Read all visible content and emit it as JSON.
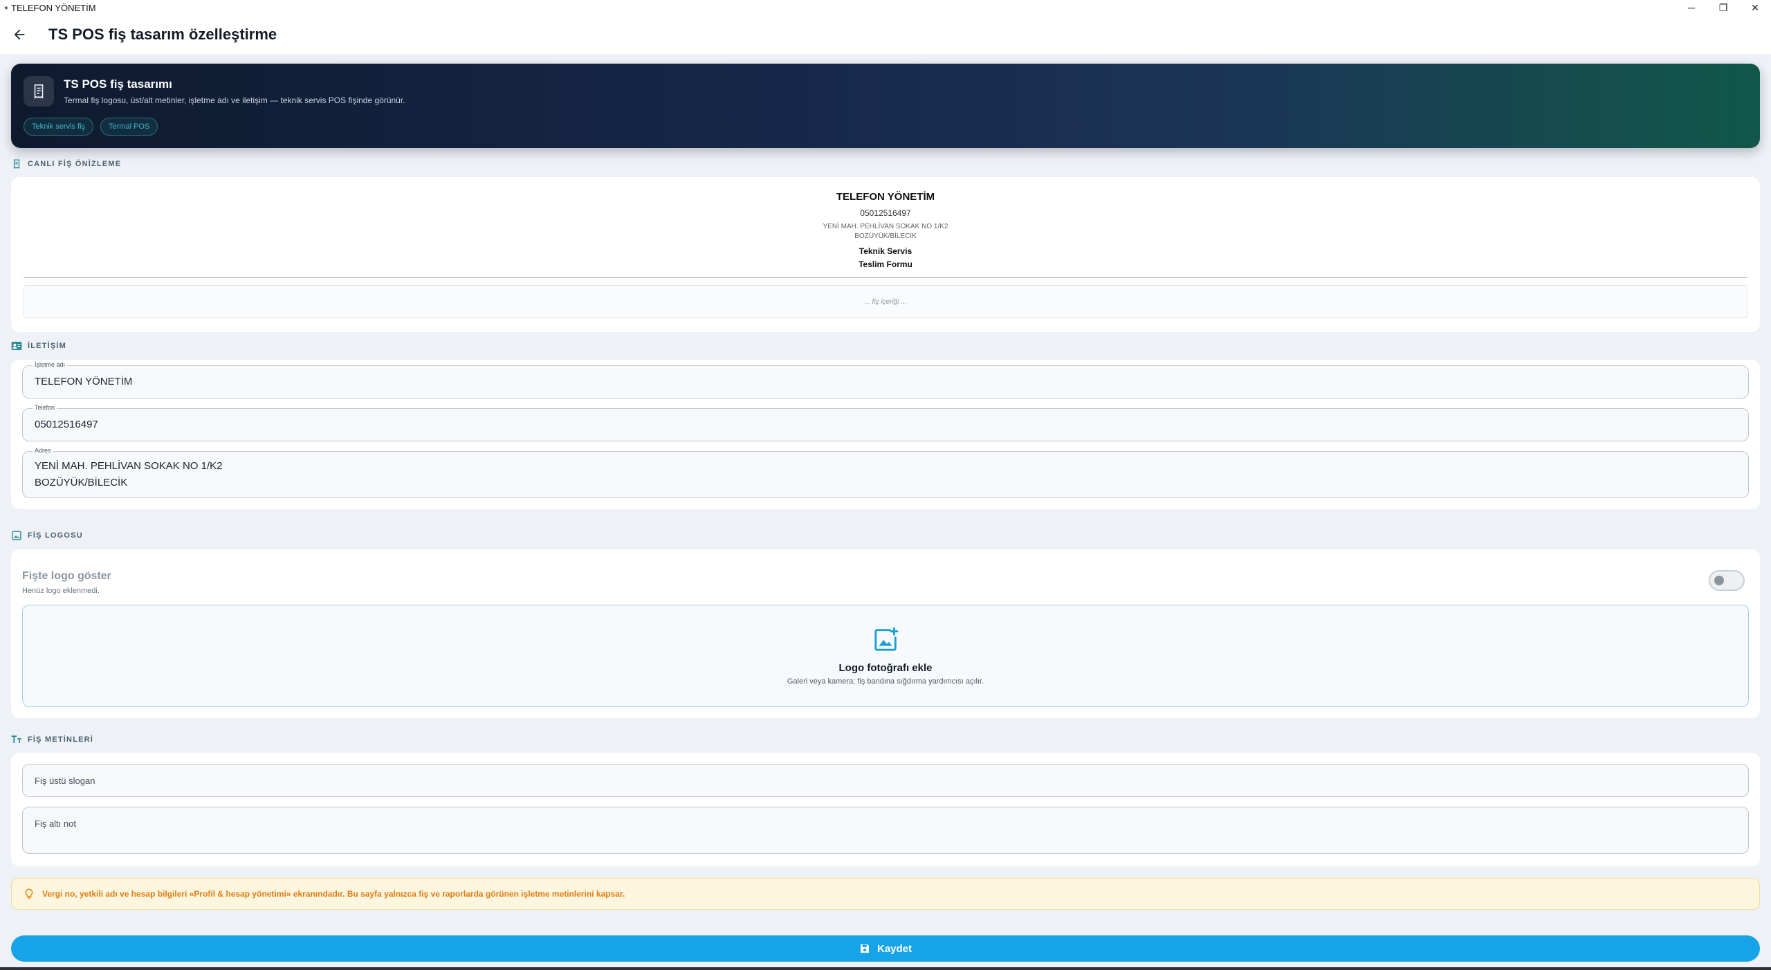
{
  "window": {
    "title": "TELEFON YÖNETİM",
    "controls": {
      "minimize": "─",
      "restore": "❐",
      "close": "✕"
    }
  },
  "appbar": {
    "back_icon": "arrow-left-icon",
    "title": "TS POS fiş tasarım özelleştirme"
  },
  "hero": {
    "icon": "receipt-icon",
    "title": "TS POS fiş tasarımı",
    "subtitle": "Termal fiş logosu, üst/alt metinler, işletme adı ve iletişim — teknik servis POS fişinde görünür.",
    "chips": [
      "Teknik servis fiş",
      "Termal POS"
    ]
  },
  "preview": {
    "section_label": "CANLI FİŞ ÖNİZLEME",
    "business_name": "TELEFON YÖNETİM",
    "phone": "05012516497",
    "address_line1": "YENİ MAH. PEHLİVAN SOKAK NO 1/K2",
    "address_line2": "BOZÜYÜK/BİLECİK",
    "doc_line1": "Teknik Servis",
    "doc_line2": "Teslim Formu",
    "body_placeholder": "... fiş içeriği ..."
  },
  "contact": {
    "section_label": "İLETİŞİM",
    "business_label": "İşletme adı",
    "business_value": "TELEFON YÖNETİM",
    "phone_label": "Telefon",
    "phone_value": "05012516497",
    "address_label": "Adres",
    "address_value": "YENİ MAH. PEHLİVAN SOKAK NO 1/K2\nBOZÜYÜK/BİLECİK"
  },
  "logo": {
    "section_label": "FİŞ LOGOSU",
    "toggle_title": "Fişte logo göster",
    "toggle_sub": "Henüz logo eklenmedi.",
    "toggle_on": false,
    "add_title": "Logo fotoğrafı ekle",
    "add_sub": "Galeri veya kamera; fiş bandına sığdırma yardımcısı açılır."
  },
  "texts": {
    "section_label": "FİŞ METİNLERİ",
    "top_placeholder": "Fiş üstü slogan",
    "bottom_placeholder": "Fiş altı not"
  },
  "info": {
    "icon": "lightbulb-icon",
    "text": "Vergi no, yetkili adı ve hesap bilgileri «Profil & hesap yönetimi» ekranındadır. Bu sayfa yalnızca fiş ve raporlarda görünen işletme metinlerini kapsar."
  },
  "save": {
    "icon": "save-icon",
    "label": "Kaydet"
  },
  "colors": {
    "accent": "#17a3e8",
    "chip_text": "#40b6c3",
    "warning_text": "#e07b12",
    "warning_bg": "#fdf6de",
    "section_label": "#4a6070"
  }
}
